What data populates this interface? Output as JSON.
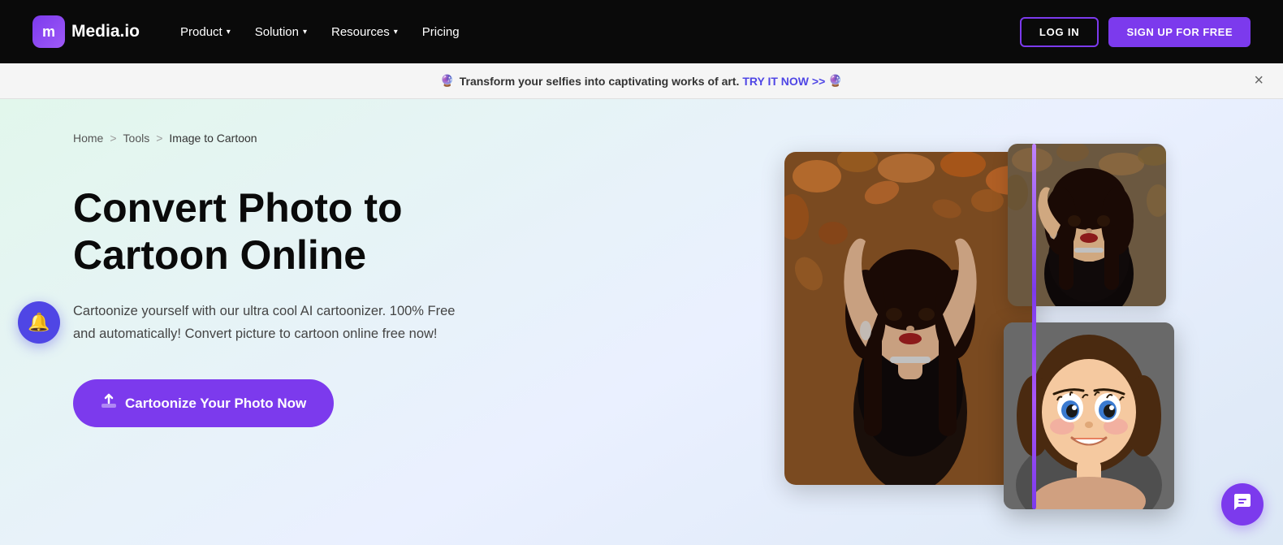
{
  "navbar": {
    "logo_text": "Media.io",
    "logo_letter": "m",
    "nav_items": [
      {
        "label": "Product",
        "has_dropdown": true
      },
      {
        "label": "Solution",
        "has_dropdown": true
      },
      {
        "label": "Resources",
        "has_dropdown": true
      },
      {
        "label": "Pricing",
        "has_dropdown": false
      }
    ],
    "login_label": "LOG IN",
    "signup_label": "SIGN UP FOR FREE"
  },
  "announcement": {
    "emoji": "🔮",
    "text": "Transform your selfies into captivating works of art.",
    "cta": "TRY IT NOW >>",
    "emoji2": "🔮",
    "close": "×"
  },
  "breadcrumb": {
    "home": "Home",
    "sep1": ">",
    "tools": "Tools",
    "sep2": ">",
    "current": "Image to Cartoon"
  },
  "hero": {
    "title": "Convert Photo to Cartoon Online",
    "description": "Cartoonize yourself with our ultra cool AI cartoonizer. 100% Free and automatically! Convert picture to cartoon online free now!",
    "cta_label": "Cartoonize Your Photo Now"
  },
  "colors": {
    "purple": "#7c3aed",
    "purple_light": "#a855f7",
    "dark": "#0a0a0a",
    "green_tint": "#e8f8f0"
  },
  "chat_icon": "💬",
  "bell_icon": "🔔"
}
